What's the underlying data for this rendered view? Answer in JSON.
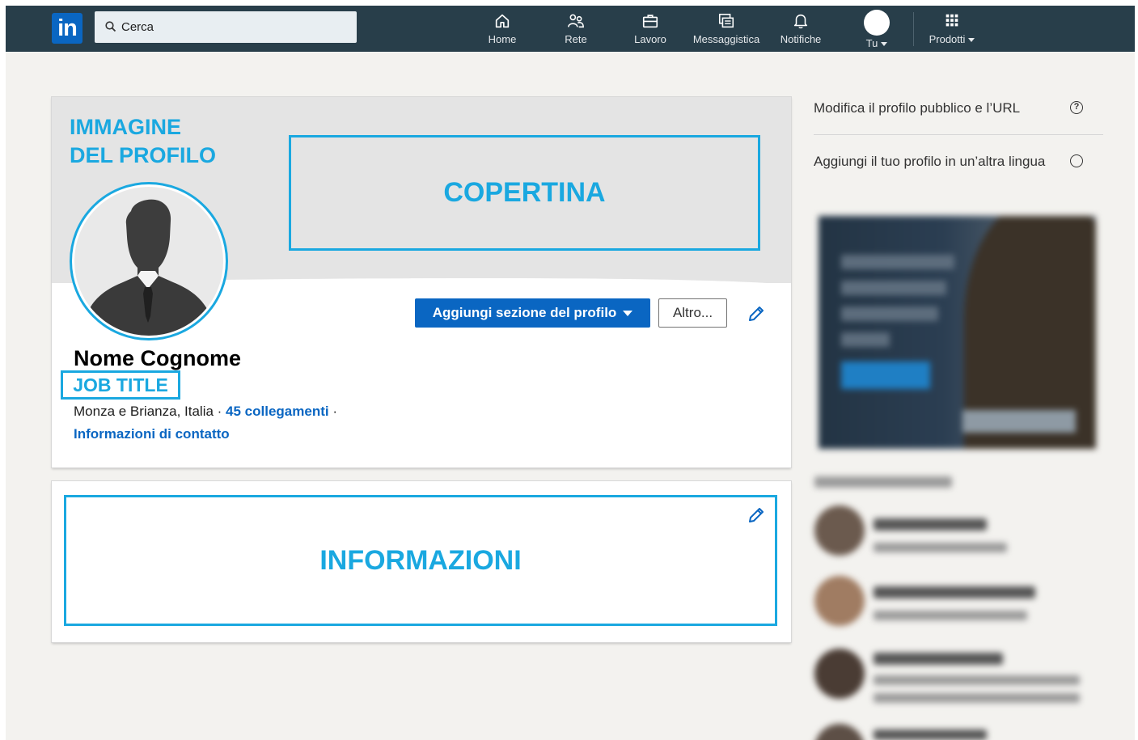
{
  "nav": {
    "logo": "in",
    "search_placeholder": "Cerca",
    "items": [
      {
        "label": "Home",
        "icon": "home-icon"
      },
      {
        "label": "Rete",
        "icon": "network-icon"
      },
      {
        "label": "Lavoro",
        "icon": "briefcase-icon"
      },
      {
        "label": "Messaggistica",
        "icon": "messaging-icon"
      },
      {
        "label": "Notifiche",
        "icon": "bell-icon"
      },
      {
        "label": "Tu",
        "icon": "avatar-icon"
      },
      {
        "label": "Prodotti",
        "icon": "grid-icon"
      }
    ]
  },
  "profile": {
    "annotation_image": "IMMAGINE DEL PROFILO",
    "annotation_image_line1": "IMMAGINE",
    "annotation_image_line2": "DEL PROFILO",
    "annotation_cover": "COPERTINA",
    "add_section_button": "Aggiungi sezione del profilo",
    "more_button": "Altro...",
    "name": "Nome Cognome",
    "job_title": "JOB TITLE",
    "location": "Monza e Brianza, Italia",
    "connections": "45 collegamenti",
    "contact_info": "Informazioni di contatto"
  },
  "about": {
    "annotation": "INFORMAZIONI"
  },
  "rail": {
    "public_profile": "Modifica il profilo pubblico e l’URL",
    "other_language": "Aggiungi il tuo profilo in un’altra lingua"
  },
  "colors": {
    "nav_bg": "#283e4a",
    "brand_blue": "#0a66c2",
    "annotation_cyan": "#1aa8e0",
    "page_bg": "#f3f2ef"
  }
}
